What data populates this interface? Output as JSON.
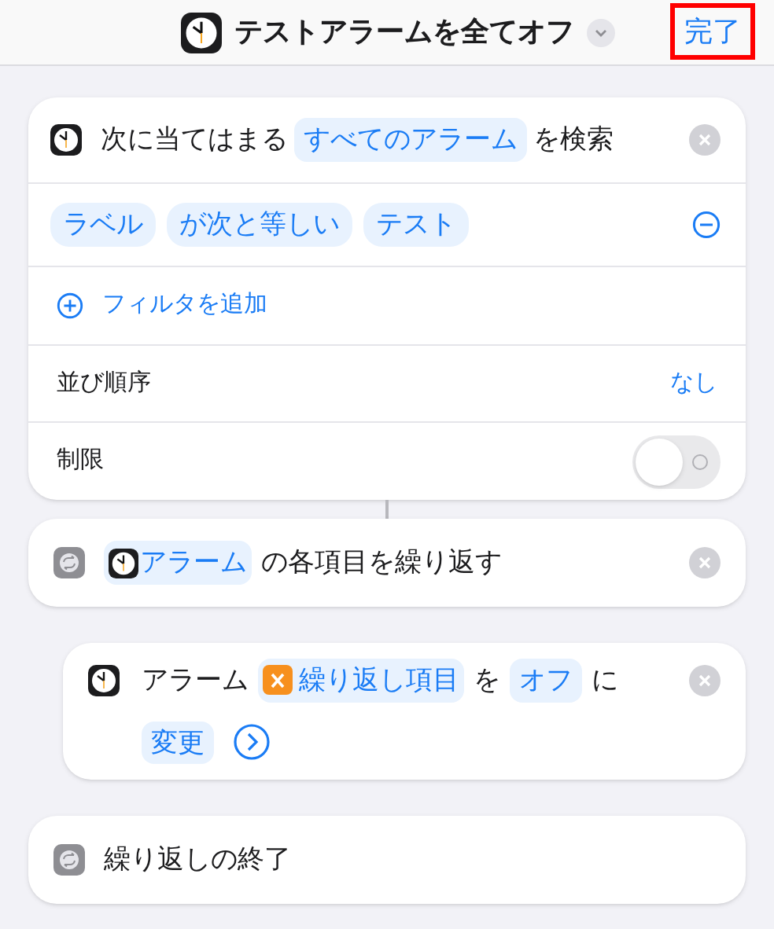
{
  "header": {
    "title": "テストアラームを全てオフ",
    "done": {
      "label": "完了",
      "highlighted": true
    }
  },
  "find_action": {
    "parts": [
      {
        "kind": "text",
        "text": "次に当てはまる"
      },
      {
        "kind": "token",
        "text": "すべてのアラーム"
      },
      {
        "kind": "text",
        "text": "を検索"
      }
    ],
    "filter": {
      "tokens": [
        "ラベル",
        "が次と等しい",
        "テスト"
      ]
    },
    "add_filter": "フィルタを追加",
    "sort": {
      "label": "並び順序",
      "value": "なし"
    },
    "limit": {
      "label": "制限",
      "on": false
    }
  },
  "repeat_action": {
    "parts": [
      {
        "kind": "clock_token",
        "text": "アラーム"
      },
      {
        "kind": "text",
        "text": "の各項目を繰り返す"
      }
    ]
  },
  "toggle_action": {
    "parts": [
      {
        "kind": "text",
        "text": "アラーム"
      },
      {
        "kind": "variable",
        "text": "繰り返し項目"
      },
      {
        "kind": "text",
        "text": "を"
      },
      {
        "kind": "token",
        "text": "オフ"
      },
      {
        "kind": "text",
        "text": "に"
      },
      {
        "kind": "break"
      },
      {
        "kind": "token",
        "text": "変更"
      },
      {
        "kind": "more"
      }
    ]
  },
  "end_action": {
    "label": "繰り返しの終了"
  }
}
